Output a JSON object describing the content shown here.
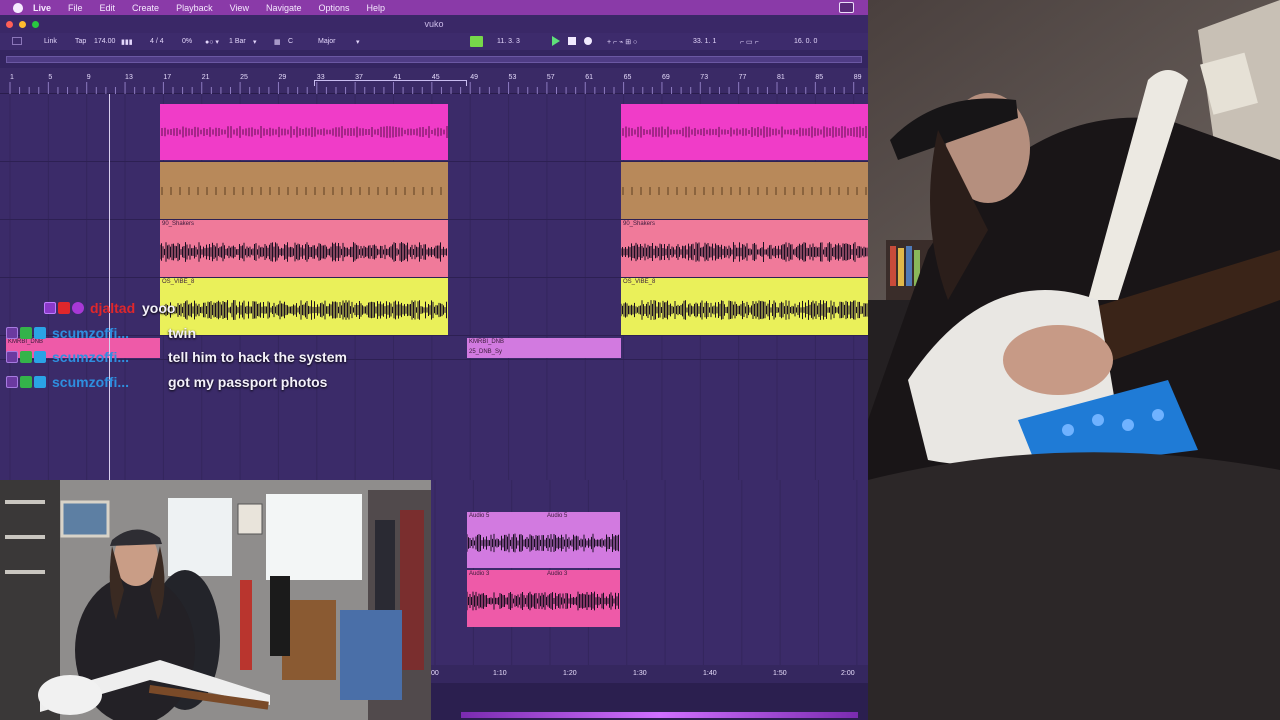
{
  "menubar": {
    "items": [
      "Live",
      "File",
      "Edit",
      "Create",
      "Playback",
      "View",
      "Navigate",
      "Options",
      "Help"
    ]
  },
  "window": {
    "title": "vuko"
  },
  "control_bar": {
    "link": "Link",
    "tap": "Tap",
    "tempo": "174.00",
    "time_signature": "4 / 4",
    "cpu": "0%",
    "quantize": "1 Bar",
    "key": "C",
    "scale": "Major",
    "song_position": "11.  3.  3",
    "loop_start": "33.  1.  1",
    "loop_length": "16.  0.  0"
  },
  "ruler": {
    "bars": [
      "1",
      "5",
      "9",
      "13",
      "17",
      "21",
      "25",
      "29",
      "33",
      "37",
      "41",
      "45",
      "49",
      "53",
      "57",
      "61",
      "65",
      "69",
      "73",
      "77",
      "81",
      "85",
      "89"
    ]
  },
  "clips": {
    "shakers_label": "90_Shakers",
    "vibe_label": "OS_VIBE_8",
    "kmrbi_label": "KMRBI_DNB",
    "dnb_label": "25_DNB_Sy",
    "audio5_label": "Audio 5",
    "audio3_label": "Audio 3"
  },
  "timeline": {
    "labels": [
      "00",
      "1:10",
      "1:20",
      "1:30",
      "1:40",
      "1:50",
      "2:00"
    ]
  },
  "chat": [
    {
      "user": "djaltad",
      "message": "yooo",
      "user_color": "#e0272b"
    },
    {
      "user": "scumzoffi...",
      "message": "twin",
      "user_color": "#2e8fe0"
    },
    {
      "user": "scumzoffi...",
      "message": "tell him to hack the system",
      "user_color": "#2e8fe0"
    },
    {
      "user": "scumzoffi...",
      "message": "got my passport photos",
      "user_color": "#2e8fe0"
    }
  ],
  "colors": {
    "menubar": "#8a3aa8",
    "arrangement_bg": "#3b2b69",
    "clip_magenta": "#f03cc8",
    "clip_tan": "#b8895a",
    "clip_pink": "#f07a9a",
    "clip_yellow": "#eaf05a",
    "clip_violet": "#d27ae0",
    "clip_hotpink": "#ee5aa8"
  }
}
